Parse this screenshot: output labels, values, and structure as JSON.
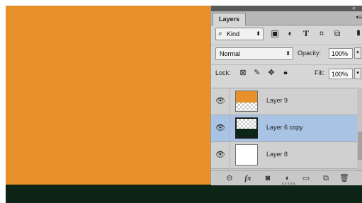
{
  "colors": {
    "canvas_fill": "#e8912a",
    "dark_band": "#0d2517",
    "selected_row": "#a8c3e3"
  },
  "panel": {
    "collapse_glyph": "«",
    "menu_glyph": "▾≡",
    "tab_label": "Layers",
    "filter": {
      "kind_value": "Kind",
      "search_icon": "search-icon",
      "icons": [
        "pixel-filter-icon",
        "adjustment-filter-icon",
        "type-filter-icon",
        "shape-filter-icon",
        "smart-object-filter-icon"
      ]
    },
    "blend_mode": "Normal",
    "opacity_label": "Opacity:",
    "opacity_value": "100%",
    "lock_label": "Lock:",
    "lock_icons": [
      "lock-transparent-icon",
      "lock-brush-icon",
      "lock-move-icon",
      "lock-all-icon"
    ],
    "fill_label": "Fill:",
    "fill_value": "100%",
    "layers": [
      {
        "name": "Layer 9",
        "selected": false,
        "thumb": "orange-on-checker"
      },
      {
        "name": "Layer 6 copy",
        "selected": true,
        "thumb": "dark-on-checker"
      },
      {
        "name": "Layer 8",
        "selected": false,
        "thumb": "white"
      }
    ],
    "bottom_icons": [
      "link-icon",
      "fx-icon",
      "mask-icon",
      "adjustment-icon",
      "folder-icon",
      "new-layer-icon",
      "trash-icon"
    ]
  }
}
